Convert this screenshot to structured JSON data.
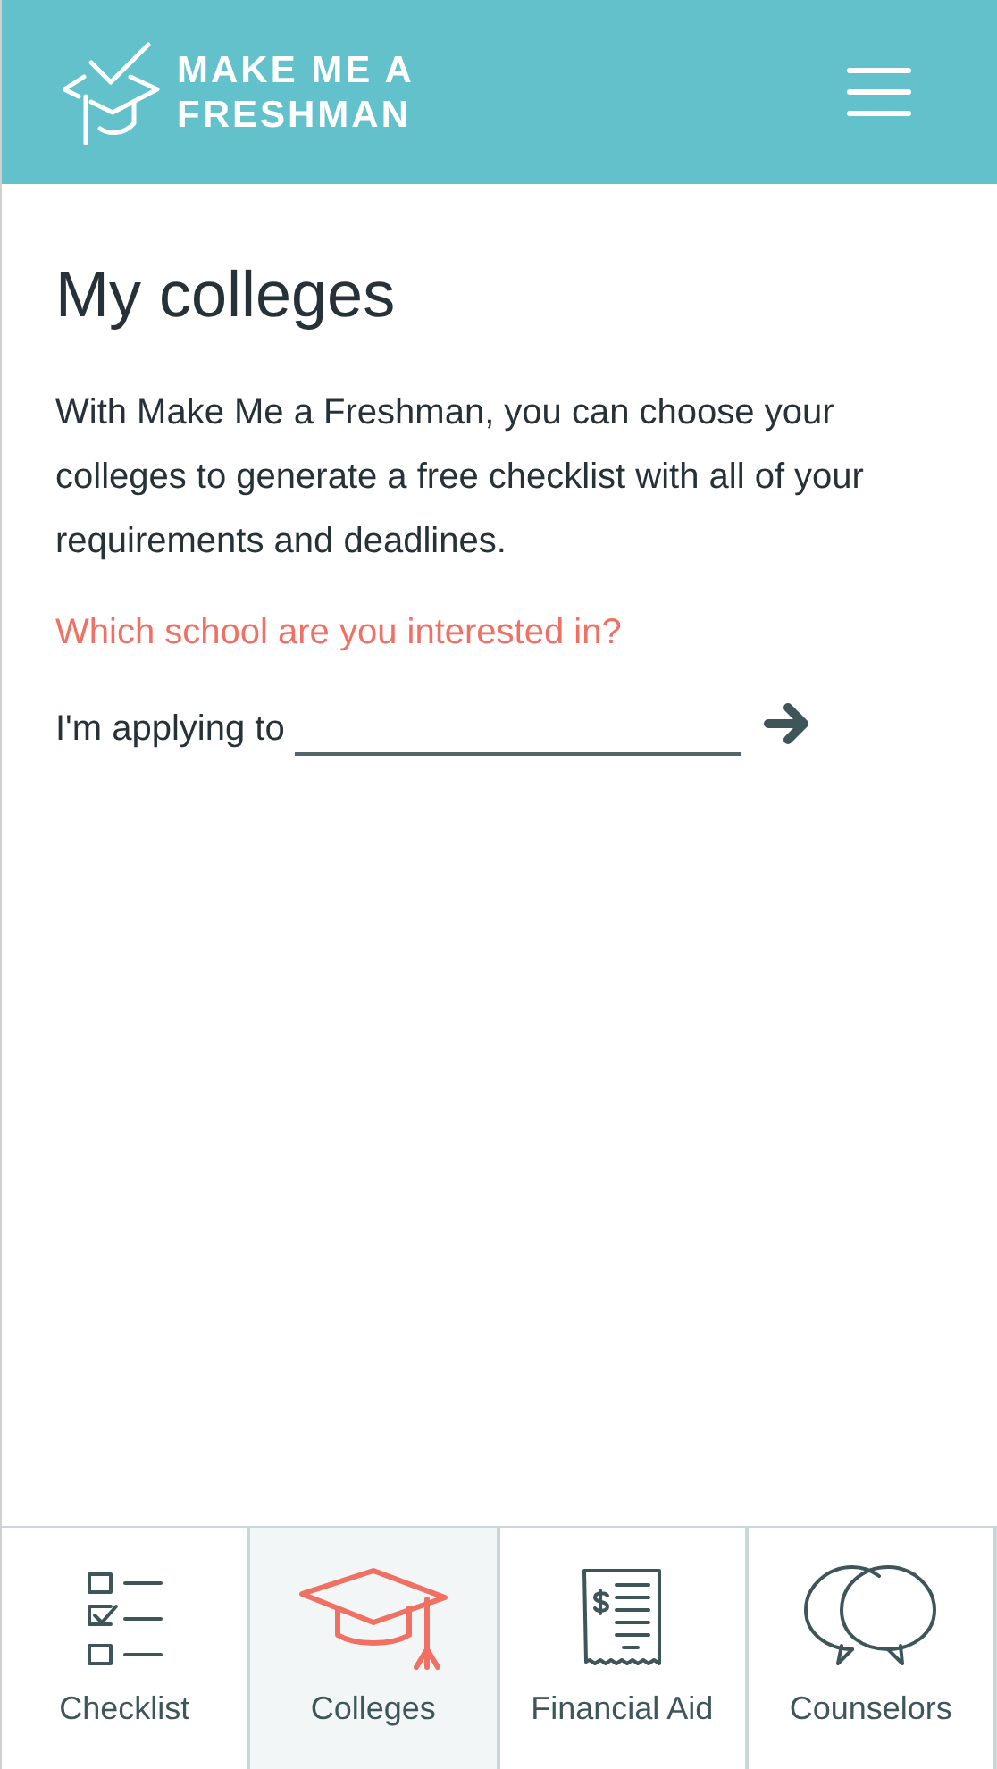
{
  "header": {
    "logo_text": [
      "MAKE ME A",
      "FRESHMAN"
    ]
  },
  "page": {
    "title": "My colleges",
    "intro": "With Make Me a Freshman, you can choose your colleges to generate a free checklist with all of your requirements and deadlines.",
    "question": "Which school are you interested in?",
    "field_label": "I'm applying to"
  },
  "tabs": [
    {
      "kind": "checklist",
      "label": "Checklist",
      "selected": false
    },
    {
      "kind": "colleges",
      "label": "Colleges",
      "selected": true
    },
    {
      "kind": "aid",
      "label": "Financial Aid",
      "selected": false
    },
    {
      "kind": "counselors",
      "label": "Counselors",
      "selected": false
    }
  ]
}
